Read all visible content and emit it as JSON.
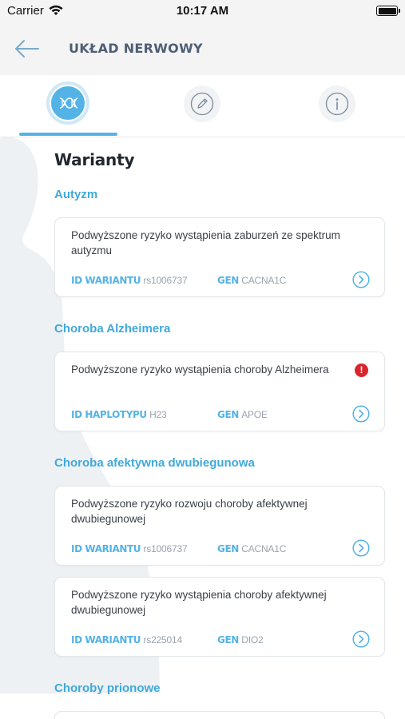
{
  "status_bar": {
    "carrier": "Carrier",
    "time": "10:17 AM"
  },
  "header": {
    "title": "UKŁAD NERWOWY"
  },
  "tabs": [
    {
      "name": "variants",
      "icon": "dna-icon",
      "active": true
    },
    {
      "name": "notes",
      "icon": "pencil-icon",
      "active": false
    },
    {
      "name": "info",
      "icon": "info-icon",
      "active": false
    }
  ],
  "section": {
    "heading": "Warianty"
  },
  "groups": [
    {
      "title": "Autyzm",
      "cards": [
        {
          "description": "Podwyższone ryzyko wystąpienia zaburzeń ze spektrum autyzmu",
          "id_label": "ID WARIANTU",
          "id_value": "rs1006737",
          "gen_label": "GEN",
          "gen_value": "CACNA1C",
          "alert": ""
        }
      ]
    },
    {
      "title": "Choroba Alzheimera",
      "cards": [
        {
          "description": "Podwyższone ryzyko wystąpienia choroby Alzheimera",
          "id_label": "ID HAPLOTYPU",
          "id_value": "H23",
          "gen_label": "GEN",
          "gen_value": "APOE",
          "alert": "!"
        }
      ]
    },
    {
      "title": "Choroba afektywna dwubiegunowa",
      "cards": [
        {
          "description": "Podwyższone ryzyko rozwoju choroby afektywnej dwubiegunowej",
          "id_label": "ID WARIANTU",
          "id_value": "rs1006737",
          "gen_label": "GEN",
          "gen_value": "CACNA1C",
          "alert": ""
        },
        {
          "description": "Podwyższone ryzyko wystąpienia choroby afektywnej dwubiegunowej",
          "id_label": "ID WARIANTU",
          "id_value": "rs225014",
          "gen_label": "GEN",
          "gen_value": "DIO2",
          "alert": ""
        }
      ]
    },
    {
      "title": "Choroby prionowe",
      "cards": []
    }
  ],
  "colors": {
    "accent": "#54b3e6",
    "alert": "#d9262c",
    "heading": "#22282f",
    "nav_title": "#4d5e75"
  }
}
